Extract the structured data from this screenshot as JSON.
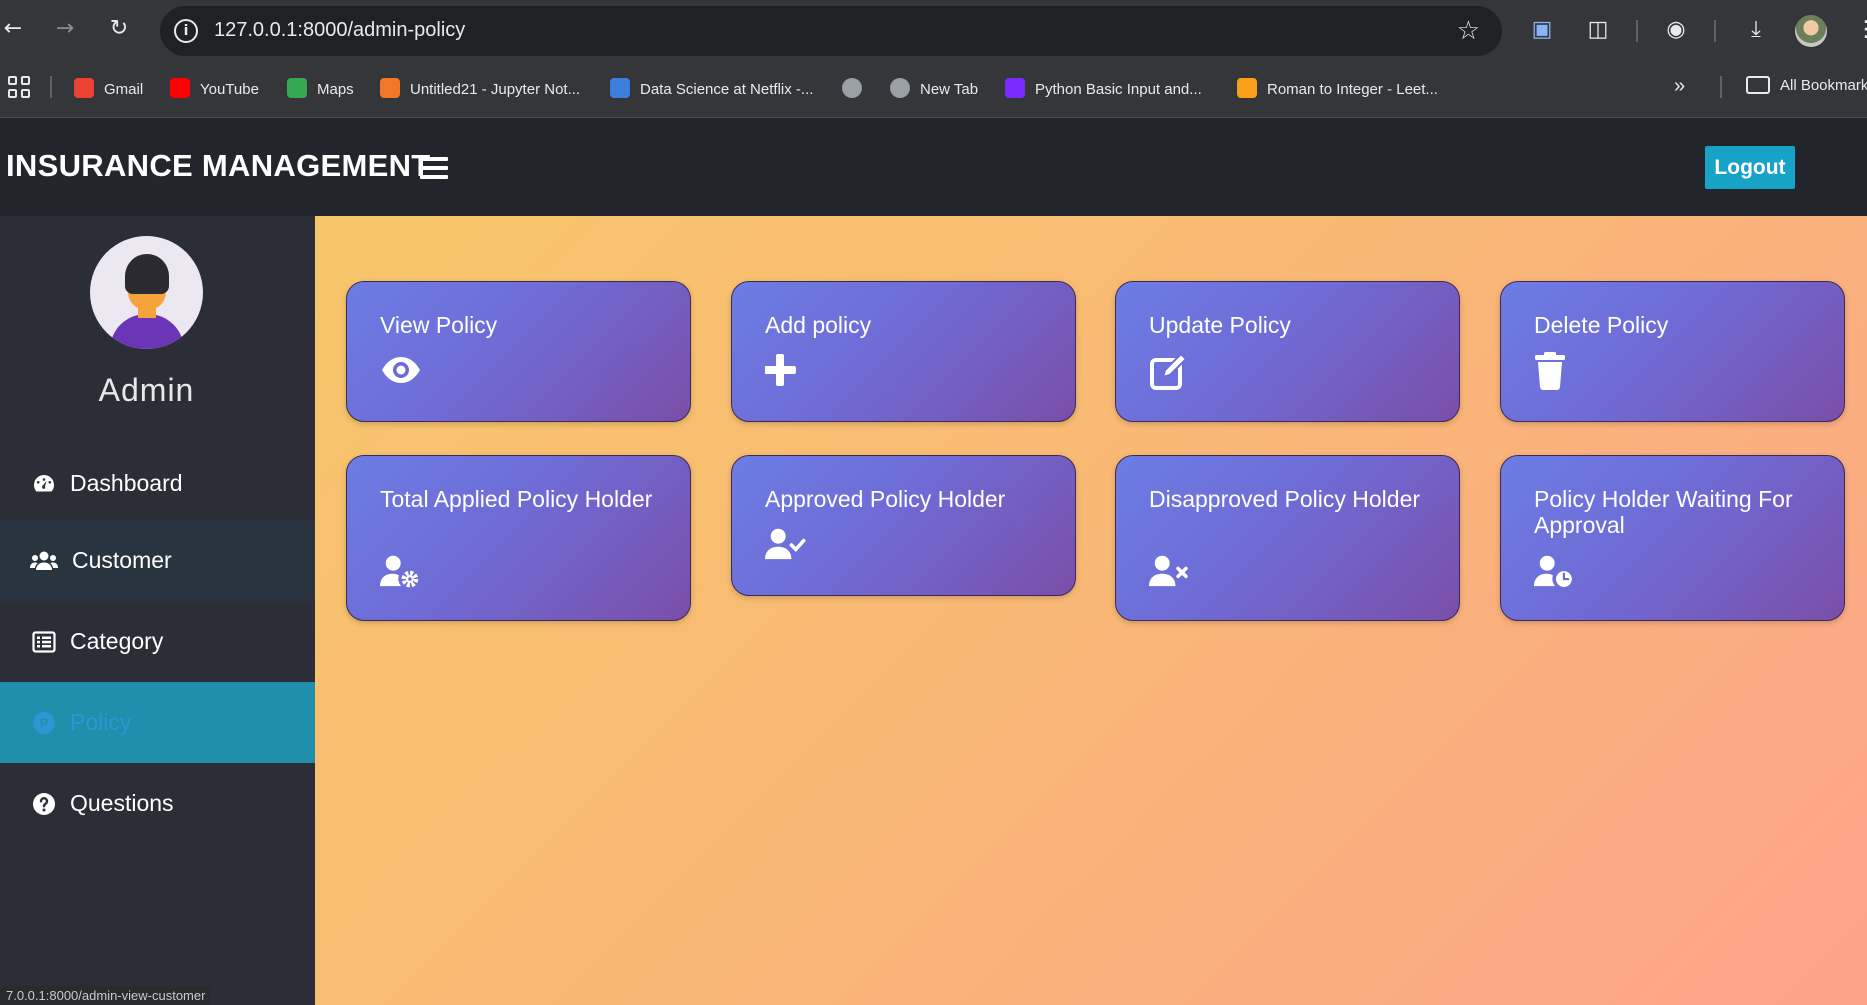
{
  "browser": {
    "url": "127.0.0.1:8000/admin-policy",
    "bookmarks": [
      {
        "label": "Gmail",
        "icon": "gmail-icon",
        "color": "#ea4335"
      },
      {
        "label": "YouTube",
        "icon": "youtube-icon",
        "color": "#ff0000"
      },
      {
        "label": "Maps",
        "icon": "maps-icon",
        "color": "#34a853"
      },
      {
        "label": "Untitled21 - Jupyter Not...",
        "icon": "jupyter-icon",
        "color": "#f37726"
      },
      {
        "label": "Data Science at Netflix -...",
        "icon": "netflix-icon",
        "color": "#3d7fe0"
      },
      {
        "label": "",
        "icon": "globe-icon",
        "color": "#9aa0a6"
      },
      {
        "label": "New Tab",
        "icon": "globe-icon",
        "color": "#9aa0a6"
      },
      {
        "label": "Python Basic Input and...",
        "icon": "python-icon",
        "color": "#7b2bff"
      },
      {
        "label": "Roman to Integer - Leet...",
        "icon": "leetcode-icon",
        "color": "#f89f1b"
      }
    ],
    "all_bookmarks": "All Bookmarks",
    "status_url": "7.0.0.1:8000/admin-view-customer"
  },
  "header": {
    "brand": "INSURANCE MANAGEMENT",
    "logout": "Logout",
    "accent": "#17a2c8"
  },
  "sidebar": {
    "user_name": "Admin",
    "items": [
      {
        "label": "Dashboard",
        "icon": "dashboard-gauge-icon"
      },
      {
        "label": "Customer",
        "icon": "users-icon"
      },
      {
        "label": "Category",
        "icon": "list-icon"
      },
      {
        "label": "Policy",
        "icon": "policy-p-icon",
        "active": true
      },
      {
        "label": "Questions",
        "icon": "question-circle-icon"
      }
    ]
  },
  "cards": [
    {
      "title": "View Policy",
      "icon": "eye-icon"
    },
    {
      "title": "Add policy",
      "icon": "plus-icon"
    },
    {
      "title": "Update Policy",
      "icon": "edit-icon"
    },
    {
      "title": "Delete Policy",
      "icon": "trash-icon"
    },
    {
      "title": "Total Applied Policy Holder",
      "icon": "user-cog-icon"
    },
    {
      "title": "Approved Policy Holder",
      "icon": "user-check-icon"
    },
    {
      "title": "Disapproved Policy Holder",
      "icon": "user-times-icon"
    },
    {
      "title": "Policy Holder Waiting For Approval",
      "icon": "user-clock-icon"
    }
  ]
}
